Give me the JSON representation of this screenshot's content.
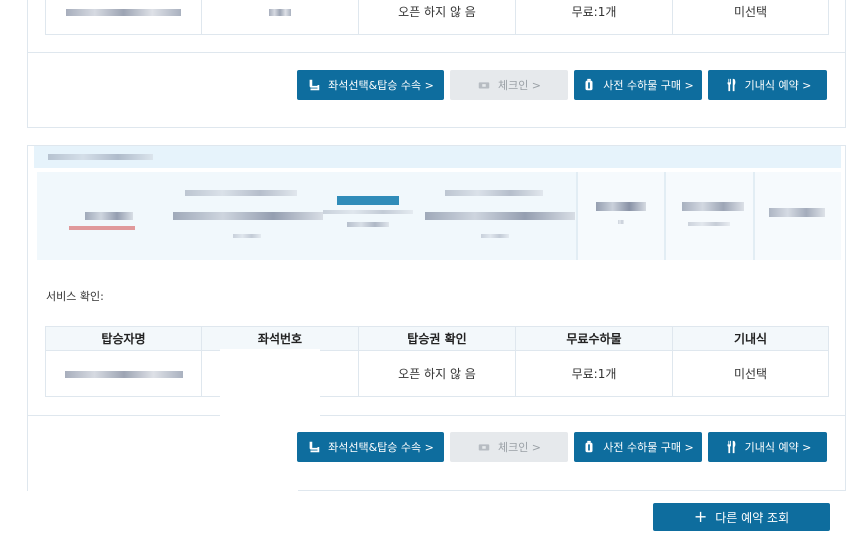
{
  "bookings": [
    {
      "service_label": "",
      "table": {
        "headers": [],
        "row": {
          "passenger": "",
          "seat": "",
          "boarding_pass": "오픈 하지 않 음",
          "baggage": "무료:1개",
          "meal": "미선택"
        }
      },
      "buttons": {
        "seat": "좌석선택&탑승 수속 >",
        "checkin": "체크인 >",
        "baggage": "사전 수하물 구매 >",
        "meal": "기내식 예약 >"
      }
    },
    {
      "service_label": "서비스 확인:",
      "table": {
        "headers": [
          "탑승자명",
          "좌석번호",
          "탑승권 확인",
          "무료수하물",
          "기내식"
        ],
        "row": {
          "passenger": "",
          "seat": "",
          "boarding_pass": "오픈 하지 않 음",
          "baggage": "무료:1개",
          "meal": "미선택"
        }
      },
      "buttons": {
        "seat": "좌석선택&탑승 수속 >",
        "checkin": "체크인 >",
        "baggage": "사전 수하물 구매 >",
        "meal": "기내식 예약 >"
      }
    }
  ],
  "more_booking_label": "다른 예약 조회",
  "colors": {
    "primary": "#0e6d9e",
    "disabled": "#e6e9ec",
    "header_bg": "#e6f3fb"
  },
  "icons": {
    "seat": "seat-icon",
    "checkin": "ticket-icon",
    "baggage": "luggage-icon",
    "meal": "cutlery-icon",
    "more": "plus-icon"
  }
}
